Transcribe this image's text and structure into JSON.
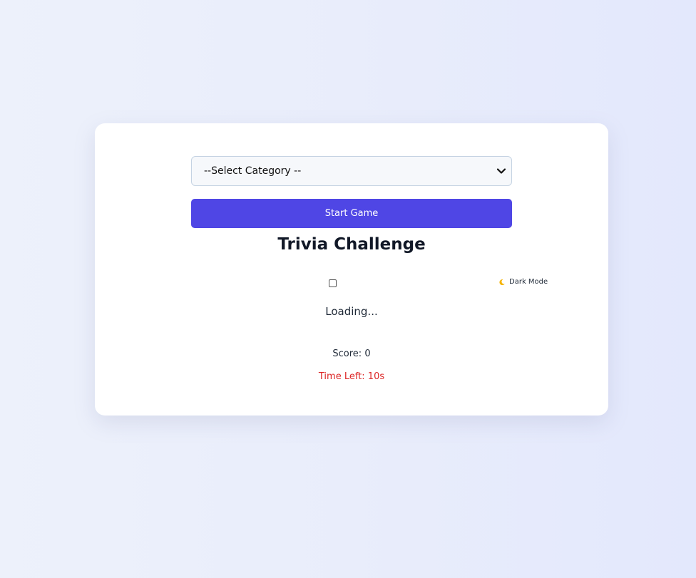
{
  "category_select": {
    "selected": "--Select Category --",
    "icon": "chevron-down-icon"
  },
  "start_button": {
    "label": "Start Game",
    "color": "#4f46e5"
  },
  "title": "Trivia Challenge",
  "dark_mode": {
    "label": "Dark Mode",
    "icon": "moon-icon",
    "checked": false
  },
  "status": {
    "loading_text": "Loading..."
  },
  "score": {
    "label": "Score: 0"
  },
  "timer": {
    "label": "Time Left: 10s",
    "color": "#dc2626"
  }
}
